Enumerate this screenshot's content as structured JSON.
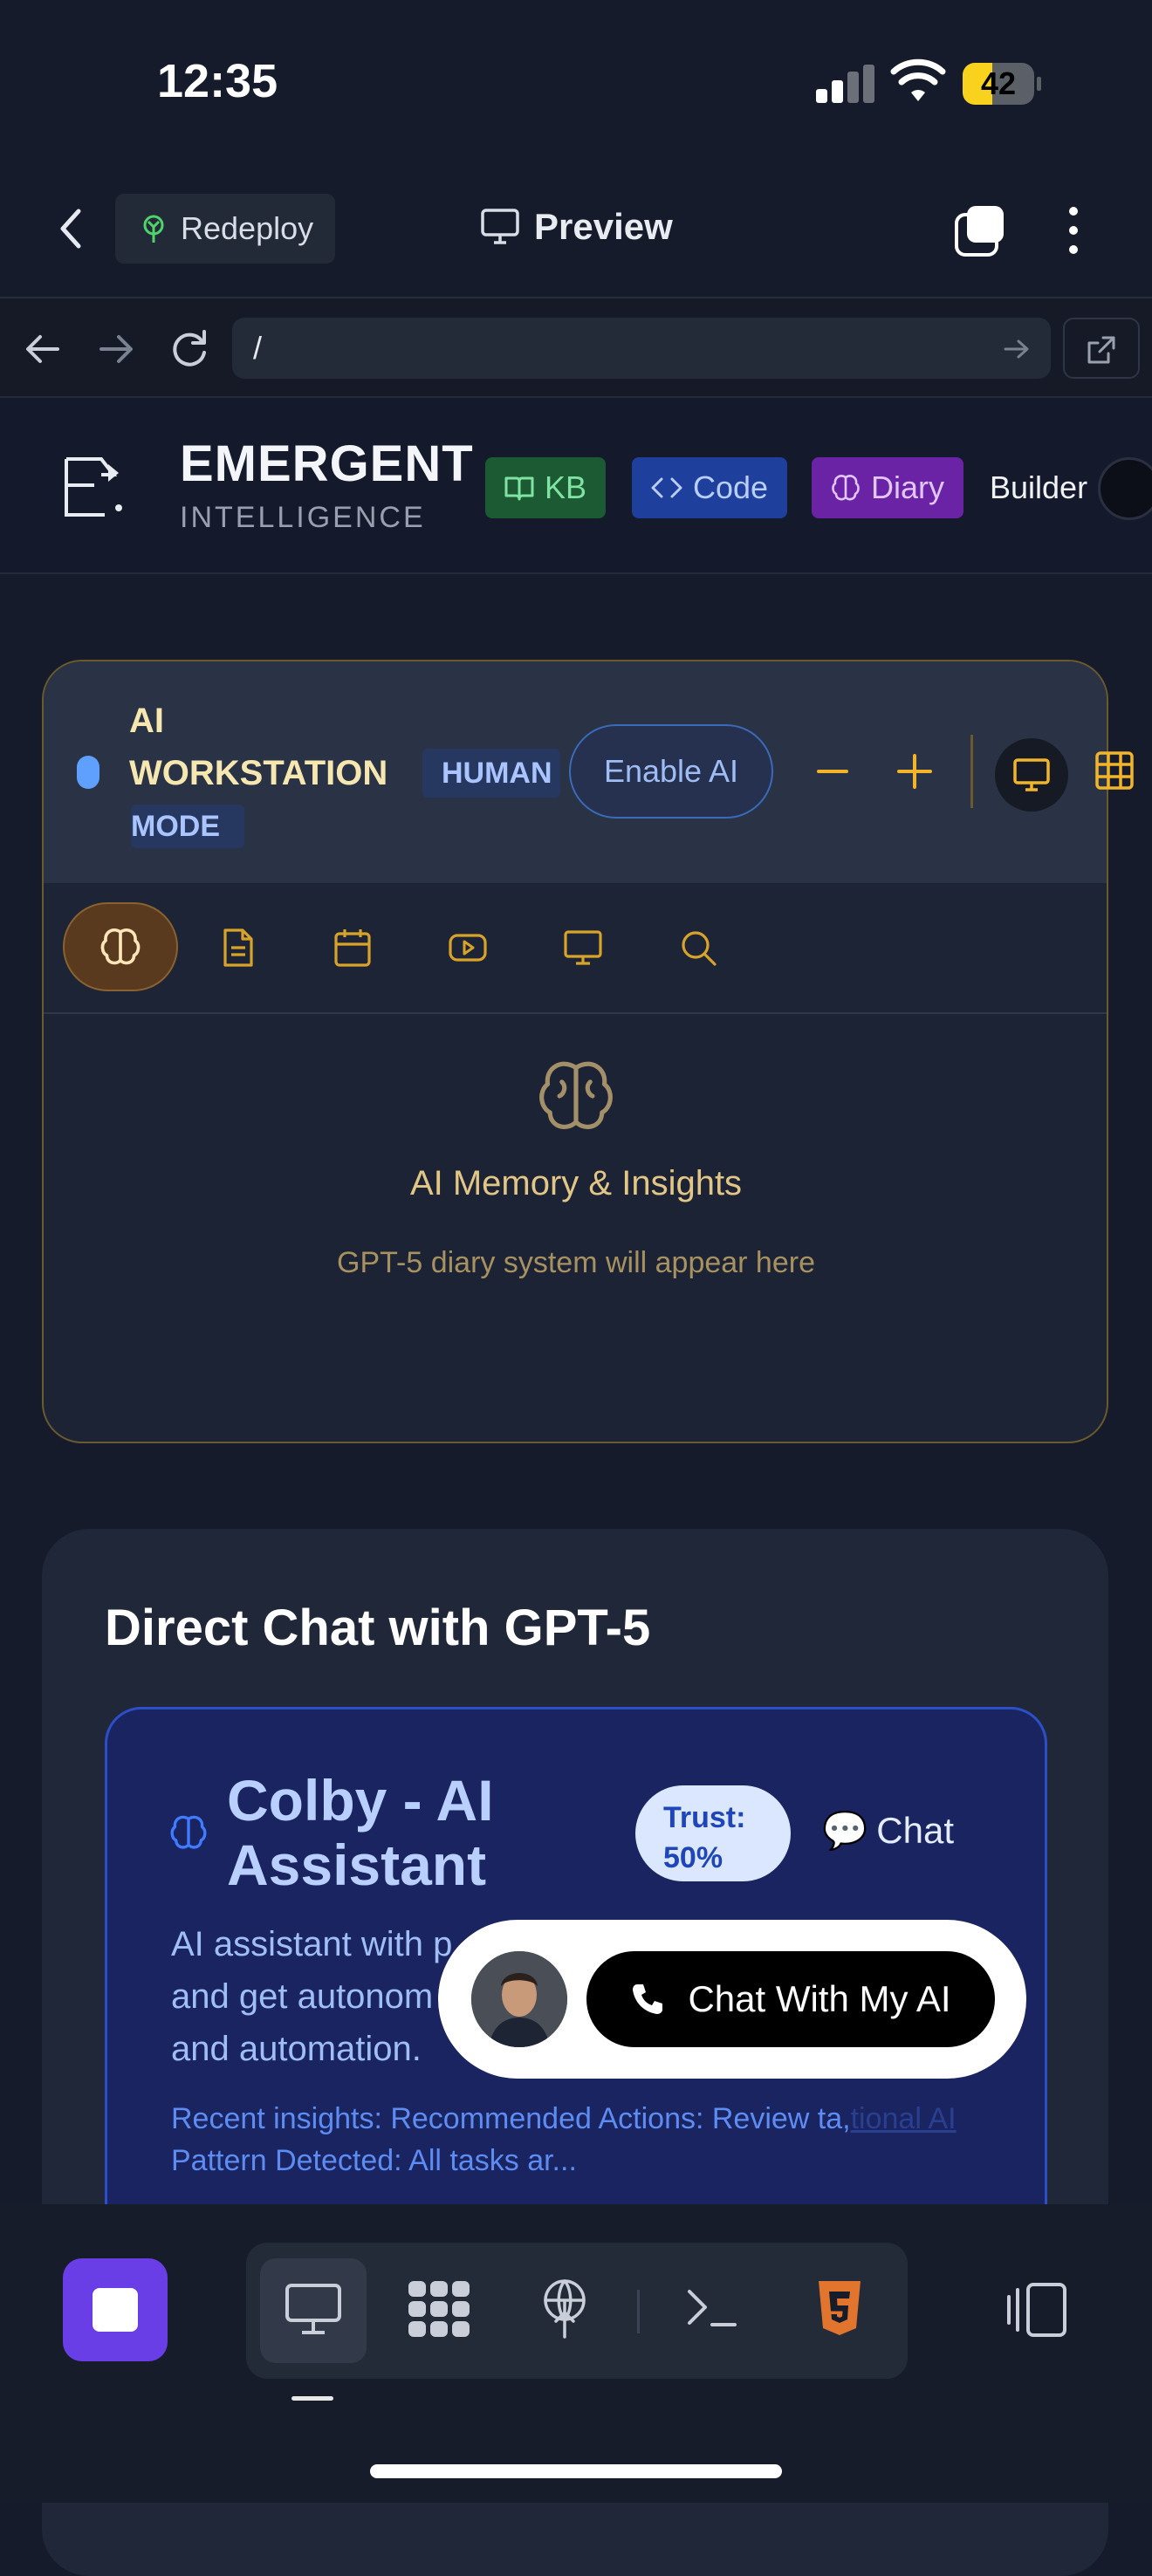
{
  "status": {
    "time": "12:35",
    "battery": "42",
    "battery_level": 0.42
  },
  "topbar": {
    "redeploy_label": "Redeploy",
    "preview_label": "Preview"
  },
  "browser": {
    "url": "/"
  },
  "app": {
    "brand_title": "EMERGENT",
    "brand_subtitle": "INTELLIGENCE",
    "nav": {
      "kb": "KB",
      "code": "Code",
      "diary": "Diary",
      "builder": "Builder"
    }
  },
  "workstation": {
    "title": "AI WORKSTATION",
    "mode_badge_primary": "HUMAN",
    "mode_badge_secondary": "MODE",
    "enable_ai_label": "Enable AI",
    "panel_title": "AI Memory & Insights",
    "panel_subtitle": "GPT-5 diary system will appear here",
    "tools": [
      "brain-icon",
      "document-icon",
      "calendar-icon",
      "video-icon",
      "monitor-icon",
      "search-icon"
    ]
  },
  "chat": {
    "heading": "Direct Chat with GPT-5",
    "assistant_name": "Colby - AI Assistant",
    "trust_label": "Trust:",
    "trust_value": "50%",
    "chat_link": "Chat",
    "description": "AI assistant with p... and get autonom... and automation.",
    "description_lines": [
      "AI assistant with p",
      "and get autonom",
      "and automation."
    ],
    "insights_line1": "Recent insights: Recommended Actions: Review ta,",
    "insights_line1_tail": "tional AI",
    "insights_line2": "Pattern Detected: All tasks ar...",
    "fab_label": "Chat With My AI"
  },
  "colors": {
    "accent_gold": "#e2c686",
    "kb_green": "#1b5a32",
    "code_blue": "#1f3f9c",
    "diary_purple": "#6a23a4",
    "stop_purple": "#6a3ee6"
  }
}
